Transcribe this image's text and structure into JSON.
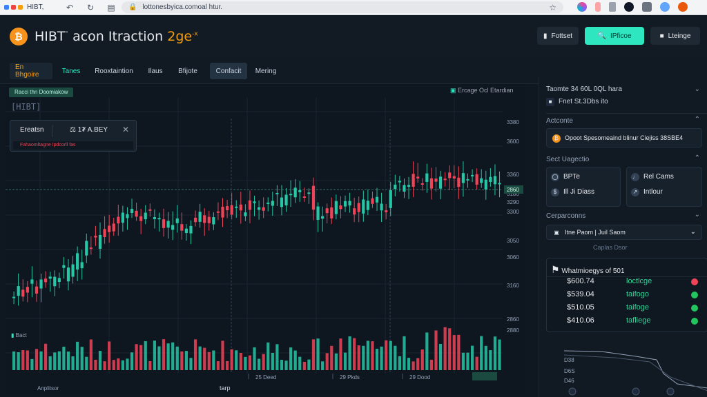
{
  "browser": {
    "tab_title": "HIBT,",
    "url": "lottonesbyica.comoal htur.",
    "back_icon": "back-arrow-icon",
    "reload_icon": "reload-icon"
  },
  "header": {
    "brand": "HIBT",
    "brand_mark": "°",
    "subtitle_main": "acon Itraction ",
    "subtitle_accent": "2ge",
    "subtitle_sup": "-x",
    "buttons": [
      {
        "label": "Fottset",
        "icon": "wallet-icon"
      },
      {
        "label": "IPficoe",
        "icon": "search-icon"
      },
      {
        "label": "Lteinge",
        "icon": "user-icon"
      }
    ],
    "accent_color": "#2ee6c0"
  },
  "tabs": [
    "En Bhgoire",
    "Tanes",
    "Rooxtaintion",
    "Ilaus",
    "Bfijote",
    "Confacit",
    "Mering"
  ],
  "active_tab": "Confacit",
  "chart": {
    "badge": "Racci thn Doomiakow",
    "pair_label": "[HIBT]",
    "panel_label": "Ereatsn",
    "panel_price": "1₮ A.BEY",
    "panel_sub": "Fahaomltagne  Ipdcorll fas",
    "top_right": "Ercage Ocl Etardian",
    "volume_label": "Bact",
    "price_ticks": [
      "3380",
      "3600",
      "3360",
      "3180",
      "3290",
      "3300",
      "3050",
      "3060",
      "3160",
      "2860",
      "2880"
    ],
    "price_current": "2860",
    "time_ticks": [
      "25 Deed",
      "29 Pkds",
      "29 Dood"
    ],
    "bottom_left": "Anplitsor",
    "bottom_center": "tarp",
    "chart_data": {
      "type": "candlestick",
      "up_color": "#26c6a6",
      "down_color": "#ef4458",
      "candles_count": 108,
      "trend": "rising"
    }
  },
  "sidebar": {
    "section1_title": "Taomte 34 60L 0QL hara",
    "section1_sub": "Fnet St.3Dbs ito",
    "section2_title": "Actconte",
    "section2_item": "Opoot Spesomeaind blinur Ciejiss 38SBE4",
    "section3_title": "Sect Uagectio",
    "cards": [
      {
        "label": "BPTe",
        "icon": "clock-icon"
      },
      {
        "label": "Rel Cams",
        "icon": "bell-icon"
      },
      {
        "label": "Ill Ji Diass",
        "icon": "dollar-icon"
      },
      {
        "label": "Intlour",
        "icon": "chart-icon"
      }
    ],
    "section4_title": "Cerparconns",
    "select_value": "Itne Paom | Juil Saom",
    "select_sub": "Caplas   Dsor",
    "watch_title": "Whatmioegys of 501",
    "watch": [
      {
        "amount": "$600.74",
        "pair": "loctlcge",
        "color": "#ef4458"
      },
      {
        "amount": "$539.04",
        "pair": "taifogo",
        "color": "#22c55e"
      },
      {
        "amount": "$510.05",
        "pair": "taifoge",
        "color": "#22c55e"
      },
      {
        "amount": "$410.06",
        "pair": "tafliege",
        "color": "#22c55e"
      }
    ],
    "mini_ticks": [
      "D38",
      "D6S",
      "D46"
    ]
  }
}
